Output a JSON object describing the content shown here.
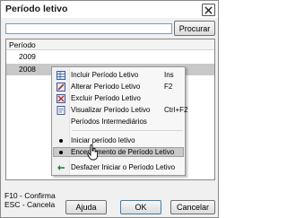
{
  "window": {
    "title": "Período letivo"
  },
  "search": {
    "value": "",
    "button_label": "Procurar"
  },
  "list": {
    "header": "Período",
    "rows": [
      "2009",
      "2008"
    ]
  },
  "context_menu": {
    "items": [
      {
        "label": "Incluir Período Letivo",
        "shortcut": "Ins",
        "icon": "add-record-icon"
      },
      {
        "label": "Alterar Período Letivo",
        "shortcut": "F2",
        "icon": "edit-pencil-icon"
      },
      {
        "label": "Excluir Período Letivo",
        "shortcut": "",
        "icon": "delete-record-icon"
      },
      {
        "label": "Visualizar Período Letivo",
        "shortcut": "Ctrl+F2",
        "icon": "view-document-icon"
      },
      {
        "label": "Períodos Intermediários",
        "shortcut": "",
        "icon": ""
      },
      {
        "label": "Iniciar período letivo",
        "shortcut": "",
        "icon": "bullet-icon"
      },
      {
        "label": "Encerramento de Período Letivo",
        "shortcut": "",
        "icon": "bullet-icon"
      },
      {
        "label": "Desfazer Iniciar o Período Letivo",
        "shortcut": "",
        "icon": "undo-arrow-icon"
      }
    ]
  },
  "footer": {
    "hint1": "F10 - Confirma",
    "hint2": "ESC - Cancela",
    "help_label": "Ajuda",
    "ok_label": "OK",
    "cancel_label": "Cancelar"
  }
}
